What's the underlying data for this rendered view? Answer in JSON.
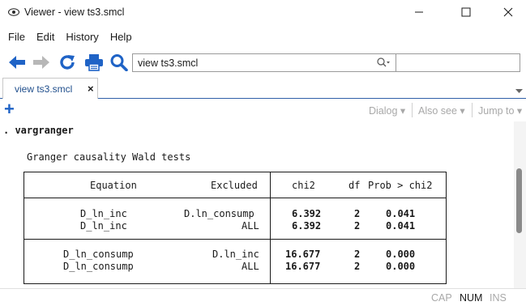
{
  "window": {
    "title": "Viewer - view ts3.smcl",
    "icon": "eye-icon"
  },
  "menu": [
    "File",
    "Edit",
    "History",
    "Help"
  ],
  "toolbar": {
    "address_value": "view ts3.smcl",
    "find_value": "",
    "icons": [
      "back-arrow-icon",
      "forward-arrow-icon",
      "refresh-icon",
      "print-icon",
      "search-icon"
    ]
  },
  "tab": {
    "label": "view ts3.smcl",
    "close": "×"
  },
  "toolbar2": {
    "dialog": "Dialog ▾",
    "also_see": "Also see ▾",
    "jump_to": "Jump to ▾"
  },
  "output": {
    "command": ". vargranger",
    "table_title": "Granger causality Wald tests",
    "columns": [
      "Equation",
      "Excluded",
      "chi2",
      "df",
      "Prob > chi2"
    ],
    "rows": [
      {
        "equation": "D_ln_inc",
        "excluded": "D.ln_consump",
        "chi2": "6.392",
        "df": "2",
        "prob": "0.041"
      },
      {
        "equation": "D_ln_inc",
        "excluded": "ALL",
        "chi2": "6.392",
        "df": "2",
        "prob": "0.041"
      },
      {
        "equation": "D_ln_consump",
        "excluded": "D.ln_inc",
        "chi2": "16.677",
        "df": "2",
        "prob": "0.000"
      },
      {
        "equation": "D_ln_consump",
        "excluded": "ALL",
        "chi2": "16.677",
        "df": "2",
        "prob": "0.000"
      }
    ]
  },
  "status": {
    "cap": "CAP",
    "num": "NUM",
    "ins": "INS"
  },
  "colors": {
    "accent": "#1f63c6",
    "tab_text": "#1f4e8c",
    "disabled": "#a8a8a8"
  }
}
